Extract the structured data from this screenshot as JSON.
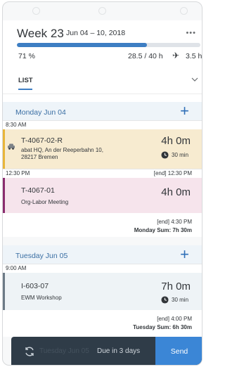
{
  "header": {
    "week_title": "Week 23",
    "date_range": "Jun 04 – 10, 2018",
    "more_icon": "more-dots-icon",
    "progress_fraction": 0.71,
    "percent": "71 %",
    "hours": "28.5 / 40 h",
    "extra": "3.5 h"
  },
  "tab": {
    "label": "LIST"
  },
  "days": [
    {
      "title": "Monday Jun 04",
      "summary": "Monday Sum: 7h 30m"
    },
    {
      "title": "Tuesday Jun 05",
      "summary": "Tuesday Sum: 6h 30m"
    }
  ],
  "entries": [
    {
      "start": "8:30 AM",
      "code": "T-4067-02-R",
      "line1": "abat HQ, An der Reeperbahn 10,",
      "line2": "28217 Bremen",
      "duration": "4h 0m",
      "travel": "30 min",
      "color": "#f7ebd0",
      "bar_color": "#e8b53a"
    },
    {
      "start": "12:30 PM",
      "end": "[end] 12:30 PM",
      "code": "T-4067-01",
      "line1": "Org-Labor Meeting",
      "duration": "4h 0m",
      "color": "#f6e4ec",
      "bar_color": "#8a2c6e"
    },
    {
      "start": "9:00 AM",
      "code": "I-603-07",
      "line1": "EWM Workshop",
      "duration": "7h 0m",
      "travel": "30 min",
      "color": "#eef3f6",
      "bar_color": "#6c7a86"
    }
  ],
  "summaries": {
    "monday_end": "[end] 4:30 PM",
    "tuesday_end": "[end] 4:00 PM"
  },
  "footer": {
    "ghost_text": "Tuesday Jun 05",
    "due": "Due in 3 days",
    "send": "Send"
  },
  "colors": {
    "accent": "#3d7ec3",
    "footer_bg": "#2f3c48",
    "send_bg": "#3b86d6"
  }
}
